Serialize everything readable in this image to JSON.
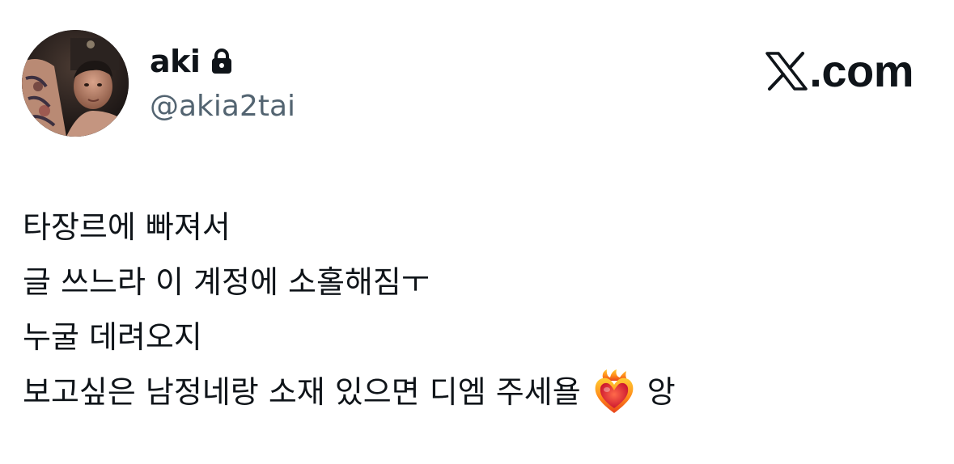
{
  "user": {
    "display_name": "aki",
    "handle": "@akia2tai",
    "protected_icon": "lock-icon",
    "avatar": "profile-photo"
  },
  "brand": {
    "icon": "x-logo-icon",
    "text": ".com"
  },
  "tweet": {
    "lines": [
      "타장르에 빠져서",
      "글 쓰느라 이 계정에 소홀해짐ㅜ",
      "누굴 데려오지"
    ],
    "last_line_text": "보고싶은 남정네랑 소재 있으면 디엠 주세욜",
    "emoji": "heart-on-fire-icon",
    "last_line_tail": "앙"
  },
  "colors": {
    "text": "#0f1419",
    "secondary_text": "#536471",
    "background": "#ffffff"
  }
}
